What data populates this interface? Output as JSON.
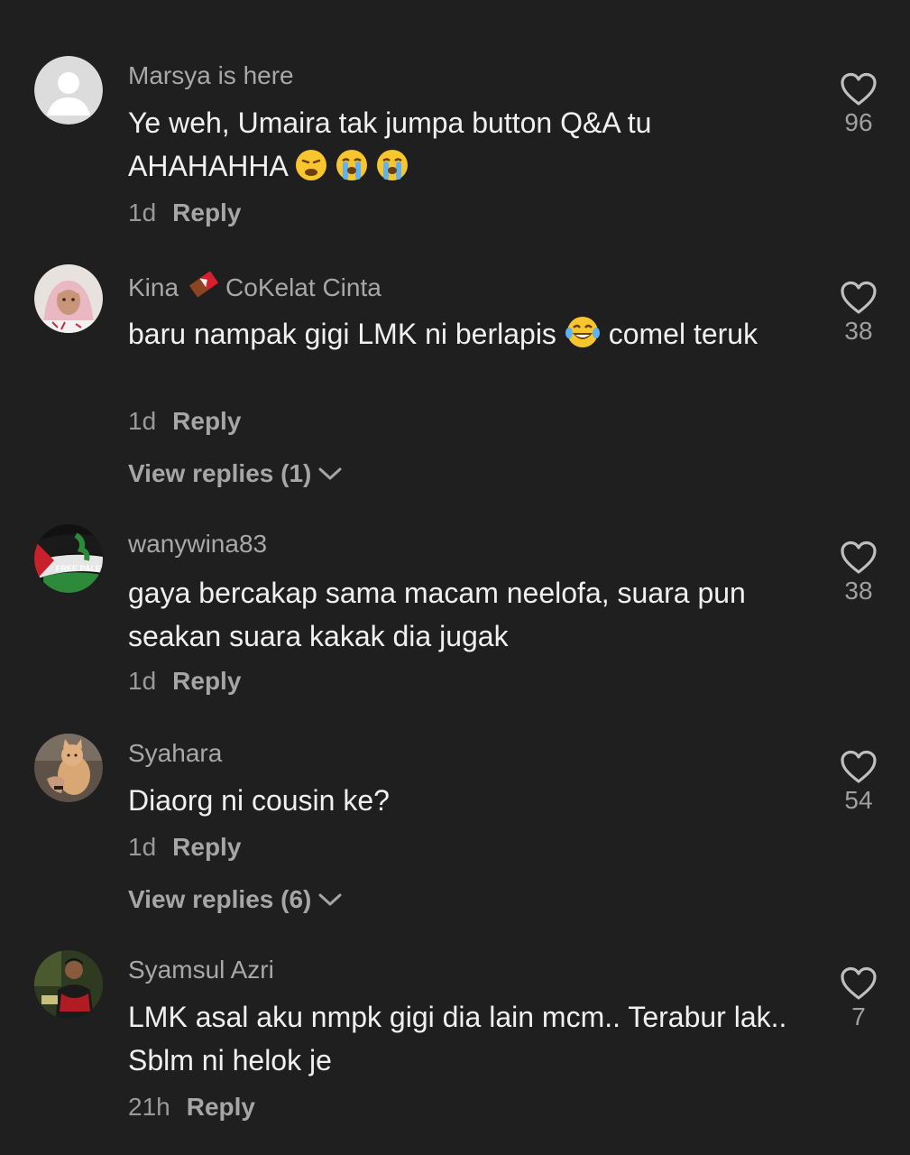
{
  "comments": [
    {
      "username": "Marsya is here",
      "text": "Ye weh, Umaira tak jumpa button Q&A tu AHAHAHHA",
      "text_emojis": [
        "weary-face",
        "loudly-crying-face",
        "loudly-crying-face"
      ],
      "time": "1d",
      "reply_label": "Reply",
      "likes": "96",
      "avatar": "default-person-avatar"
    },
    {
      "username_prefix": "Kina",
      "username_emoji": "chocolate-bar",
      "username_suffix": "CoKelat Cinta",
      "text_before": "baru nampak gigi LMK ni berlapis",
      "text_emoji": "face-with-tears-of-joy",
      "text_after": "comel teruk",
      "time": "1d",
      "reply_label": "Reply",
      "view_replies": "View replies (1)",
      "likes": "38",
      "avatar": "hijab-selfie-avatar"
    },
    {
      "username": "wanywina83",
      "avatar_text": "FREE PALESTIN",
      "text": "gaya bercakap sama macam neelofa, suara pun seakan suara kakak dia jugak",
      "time": "1d",
      "reply_label": "Reply",
      "likes": "38",
      "avatar": "palestine-flag-avatar"
    },
    {
      "username": "Syahara",
      "text": "Diaorg ni cousin ke?",
      "time": "1d",
      "reply_label": "Reply",
      "view_replies": "View replies (6)",
      "likes": "54",
      "avatar": "cat-photo-avatar"
    },
    {
      "username": "Syamsul Azri",
      "text": "LMK asal aku nmpk gigi dia lain mcm.. Terabur lak.. Sblm ni helok je",
      "time": "21h",
      "reply_label": "Reply",
      "likes": "7",
      "avatar": "man-photo-avatar"
    }
  ],
  "colors": {
    "background": "#1f1f1f",
    "username": "#a8a8a8",
    "text": "#f0f0f0",
    "meta": "#9a9a9a"
  }
}
